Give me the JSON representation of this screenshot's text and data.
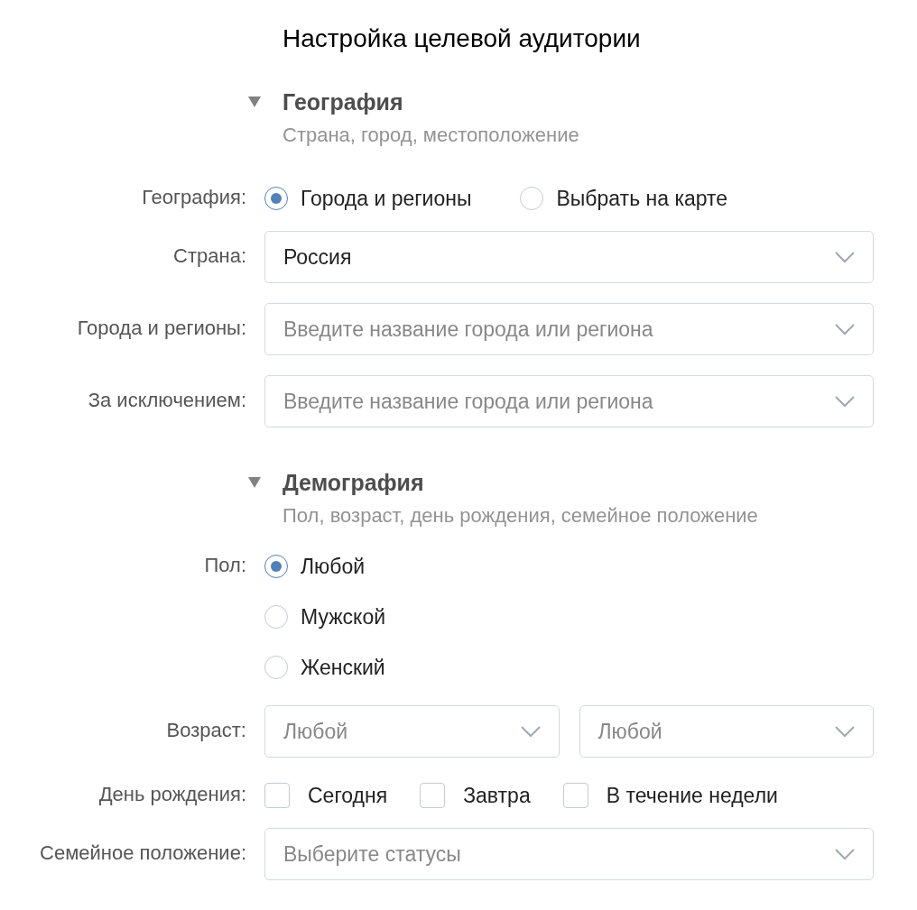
{
  "title": "Настройка целевой аудитории",
  "sections": [
    {
      "title": "География",
      "subtitle": "Страна, город, местоположение",
      "expanded": true,
      "rows": [
        {
          "kind": "radio_row",
          "label": "География:",
          "options": [
            {
              "label": "Города и регионы",
              "selected": true
            },
            {
              "label": "Выбрать на карте",
              "selected": false
            }
          ]
        },
        {
          "kind": "select",
          "label": "Страна:",
          "selects": [
            {
              "value": "Россия"
            }
          ]
        },
        {
          "kind": "select",
          "label": "Города и регионы:",
          "selects": [
            {
              "placeholder": "Введите название города или региона"
            }
          ]
        },
        {
          "kind": "select",
          "label": "За исключением:",
          "selects": [
            {
              "placeholder": "Введите название города или региона"
            }
          ]
        }
      ]
    },
    {
      "title": "Демография",
      "subtitle": "Пол, возраст, день рождения, семейное положение",
      "expanded": true,
      "rows": [
        {
          "kind": "radio_column",
          "label": "Пол:",
          "options": [
            {
              "label": "Любой",
              "selected": true
            },
            {
              "label": "Мужской",
              "selected": false
            },
            {
              "label": "Женский",
              "selected": false
            }
          ]
        },
        {
          "kind": "select",
          "label": "Возраст:",
          "selects": [
            {
              "placeholder": "Любой"
            },
            {
              "placeholder": "Любой"
            }
          ]
        },
        {
          "kind": "checkbox",
          "label": "День рождения:",
          "options": [
            {
              "label": "Сегодня",
              "checked": false
            },
            {
              "label": "Завтра",
              "checked": false
            },
            {
              "label": "В течение недели",
              "checked": false
            }
          ]
        },
        {
          "kind": "select",
          "label": "Семейное положение:",
          "selects": [
            {
              "placeholder": "Выберите статусы"
            }
          ]
        }
      ]
    }
  ]
}
